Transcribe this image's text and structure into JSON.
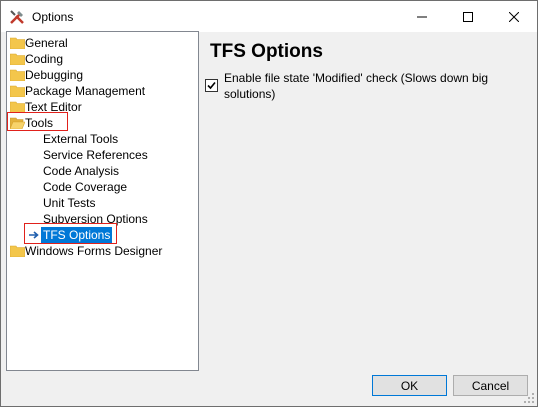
{
  "window": {
    "title": "Options"
  },
  "tree": {
    "items": [
      {
        "label": "General",
        "kind": "folder"
      },
      {
        "label": "Coding",
        "kind": "folder"
      },
      {
        "label": "Debugging",
        "kind": "folder"
      },
      {
        "label": "Package Management",
        "kind": "folder"
      },
      {
        "label": "Text Editor",
        "kind": "folder"
      },
      {
        "label": "Tools",
        "kind": "folder-open",
        "expanded": true
      },
      {
        "label": "External Tools",
        "kind": "child"
      },
      {
        "label": "Service References",
        "kind": "child"
      },
      {
        "label": "Code Analysis",
        "kind": "child"
      },
      {
        "label": "Code Coverage",
        "kind": "child"
      },
      {
        "label": "Unit Tests",
        "kind": "child"
      },
      {
        "label": "Subversion Options",
        "kind": "child"
      },
      {
        "label": "TFS Options",
        "kind": "child",
        "selected": true
      },
      {
        "label": "Windows Forms Designer",
        "kind": "folder"
      }
    ]
  },
  "panel": {
    "title": "TFS Options",
    "checkbox_label": "Enable file state 'Modified' check (Slows down big solutions)",
    "checkbox_checked": true
  },
  "buttons": {
    "ok": "OK",
    "cancel": "Cancel"
  },
  "colors": {
    "selection": "#0078d7",
    "highlight_box": "#e0211b",
    "folder": "#f3c64b"
  },
  "icons": {
    "app": "tools-icon",
    "minimize": "minimize-icon",
    "maximize": "maximize-icon",
    "close": "close-icon",
    "folder": "folder-icon",
    "open_folder": "folder-open-icon",
    "arrow": "right-arrow-icon"
  }
}
